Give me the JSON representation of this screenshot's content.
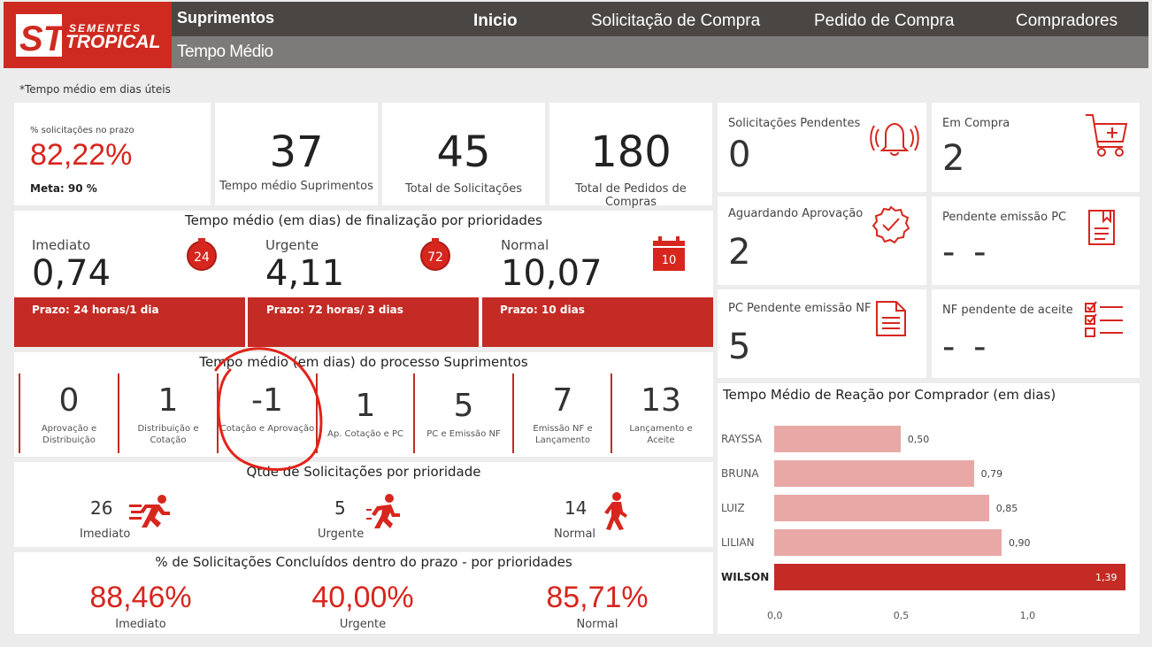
{
  "header": {
    "logo_top": "SEMENTES",
    "logo_bottom": "TROPICAL",
    "logo_mark": "ST",
    "app_title": "Suprimentos",
    "page_title": "Tempo Médio",
    "nav": [
      "Inicio",
      "Solicitação de Compra",
      "Pedido de Compra",
      "Compradores"
    ]
  },
  "note": "*Tempo médio em dias úteis",
  "kpis": {
    "pct_prazo_label": "% solicitações no prazo",
    "pct_prazo_value": "82,22%",
    "meta": "Meta: 90 %",
    "tempo_medio_value": "37",
    "tempo_medio_label": "Tempo médio Suprimentos",
    "total_sol_value": "45",
    "total_sol_label": "Total de Solicitações",
    "total_ped_value": "180",
    "total_ped_label": "Total de Pedidos de Compras"
  },
  "prioridades": {
    "title": "Tempo médio (em dias) de finalização por prioridades",
    "items": [
      {
        "label": "Imediato",
        "value": "0,74",
        "badge": "24",
        "prazo": "Prazo: 24 horas/1 dia"
      },
      {
        "label": "Urgente",
        "value": "4,11",
        "badge": "72",
        "prazo": "Prazo: 72 horas/ 3 dias"
      },
      {
        "label": "Normal",
        "value": "10,07",
        "badge": "10",
        "prazo": "Prazo: 10 dias"
      }
    ]
  },
  "processo": {
    "title": "Tempo médio (em dias) do processo Suprimentos",
    "steps": [
      {
        "value": "0",
        "label": "Aprovação e Distribuição"
      },
      {
        "value": "1",
        "label": "Distribuição e Cotação"
      },
      {
        "value": "-1",
        "label": "Cotação e Aprovação"
      },
      {
        "value": "1",
        "label": "Ap. Cotação e PC"
      },
      {
        "value": "5",
        "label": "PC e Emissão NF"
      },
      {
        "value": "7",
        "label": "Emissão NF e Lançamento"
      },
      {
        "value": "13",
        "label": "Lançamento e Aceite"
      }
    ]
  },
  "qtde": {
    "title": "Qtde de Solicitações por prioridade",
    "items": [
      {
        "value": "26",
        "label": "Imediato"
      },
      {
        "value": "5",
        "label": "Urgente"
      },
      {
        "value": "14",
        "label": "Normal"
      }
    ]
  },
  "pct_prazo": {
    "title": "% de Solicitações Concluídos dentro do prazo - por prioridades",
    "items": [
      {
        "value": "88,46%",
        "label": "Imediato"
      },
      {
        "value": "40,00%",
        "label": "Urgente"
      },
      {
        "value": "85,71%",
        "label": "Normal"
      }
    ]
  },
  "status_cards": [
    {
      "title": "Solicitações Pendentes",
      "value": "0",
      "icon": "bell-icon"
    },
    {
      "title": "Em Compra",
      "value": "2",
      "icon": "cart-icon"
    },
    {
      "title": "Aguardando Aprovação",
      "value": "2",
      "icon": "check-badge-icon"
    },
    {
      "title": "Pendente emissão PC",
      "value": "- -",
      "icon": "document-icon"
    },
    {
      "title": "PC Pendente emissão NF",
      "value": "5",
      "icon": "file-icon"
    },
    {
      "title": "NF pendente de aceite",
      "value": "- -",
      "icon": "checklist-icon"
    }
  ],
  "colors": {
    "accent": "#d7261e",
    "bar_dark": "#c32b24",
    "bar_light": "#e8a9a6",
    "header_dark": "#4a4643",
    "header_sub": "#7d7b79"
  },
  "chart_data": {
    "type": "bar",
    "orientation": "horizontal",
    "title": "Tempo Médio de Reação por Comprador (em dias)",
    "categories": [
      "RAYSSA",
      "BRUNA",
      "LUIZ",
      "LILIAN",
      "WILSON"
    ],
    "values": [
      0.5,
      0.79,
      0.85,
      0.9,
      1.39
    ],
    "value_labels": [
      "0,50",
      "0,79",
      "0,85",
      "0,90",
      "1,39"
    ],
    "highlighted": "WILSON",
    "xlim": [
      0,
      1.39
    ],
    "x_ticks": [
      0,
      0.5,
      1.0
    ],
    "x_tick_labels": [
      "0,0",
      "0,5",
      "1,0"
    ],
    "grid": false
  }
}
